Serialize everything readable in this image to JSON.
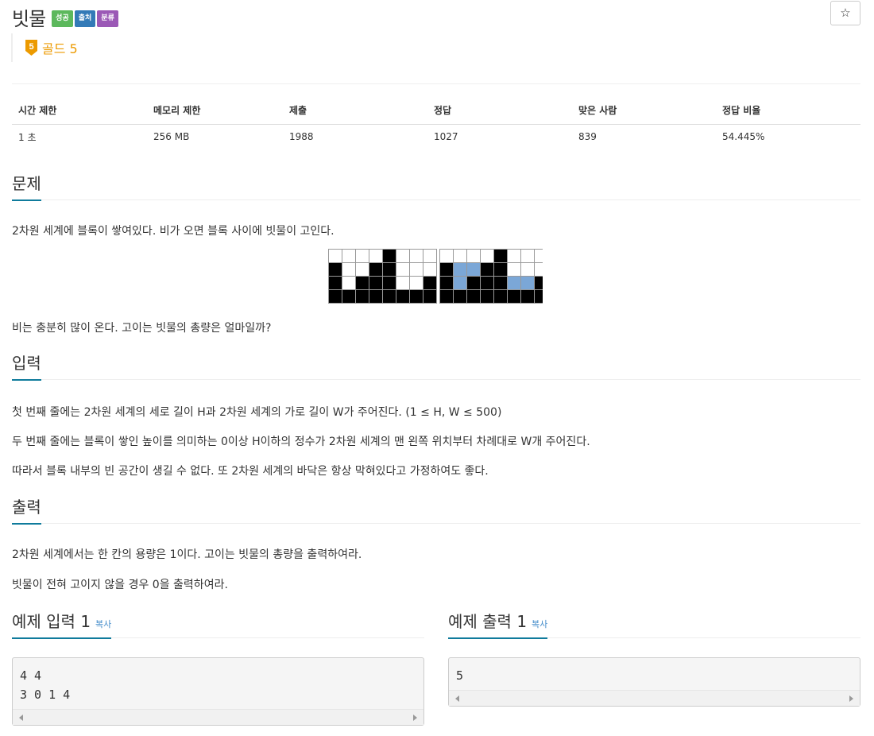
{
  "problem": {
    "title": "빗물",
    "labels": [
      {
        "text": "성공",
        "color": "#5cb85c"
      },
      {
        "text": "출처",
        "color": "#337ab7"
      },
      {
        "text": "분류",
        "color": "#9b59b6"
      }
    ],
    "star_symbol": "☆",
    "tier": {
      "number": "5",
      "text": "골드 5",
      "color": "#ec9a00",
      "icon": "gold-tier-icon"
    }
  },
  "info_table": {
    "headers": [
      "시간 제한",
      "메모리 제한",
      "제출",
      "정답",
      "맞은 사람",
      "정답 비율"
    ],
    "values": [
      "1 초",
      "256 MB",
      "1988",
      "1027",
      "839",
      "54.445%"
    ]
  },
  "sections": {
    "problem": {
      "heading": "문제",
      "text1": "2차원 세계에 블록이 쌓여있다. 비가 오면 블록 사이에 빗물이 고인다.",
      "text2": "비는 충분히 많이 온다. 고이는 빗물의 총량은 얼마일까?"
    },
    "input": {
      "heading": "입력",
      "lines": [
        "첫 번째 줄에는 2차원 세계의 세로 길이 H과 2차원 세계의 가로 길이 W가 주어진다. (1 ≤ H, W ≤ 500)",
        "두 번째 줄에는 블록이 쌓인 높이를 의미하는 0이상 H이하의 정수가 2차원 세계의 맨 왼쪽 위치부터 차례대로 W개 주어진다.",
        "따라서 블록 내부의 빈 공간이 생길 수 없다. 또 2차원 세계의 바닥은 항상 막혀있다고 가정하여도 좋다."
      ]
    },
    "output": {
      "heading": "출력",
      "lines": [
        "2차원 세계에서는 한 칸의 용량은 1이다. 고이는 빗물의 총량을 출력하여라.",
        "빗물이 전혀 고이지 않을 경우 0을 출력하여라."
      ]
    },
    "sample_input": {
      "heading": "예제 입력 1",
      "copy": "복사",
      "content": "4 4\n3 0 1 4"
    },
    "sample_output": {
      "heading": "예제 출력 1",
      "copy": "복사",
      "content": "5"
    }
  },
  "figure": {
    "colors": {
      "block": "#000000",
      "water": "#7ba7d7",
      "empty": "#ffffff"
    },
    "left_grid": [
      "E E E E B E E E",
      "B E E B B E E E",
      "B E B B B E E B",
      "B B B B B B B B"
    ],
    "right_grid": [
      "E E E E B E E E",
      "B W W B B E E E",
      "B W B B B W W B",
      "B B B B B B B B"
    ]
  }
}
